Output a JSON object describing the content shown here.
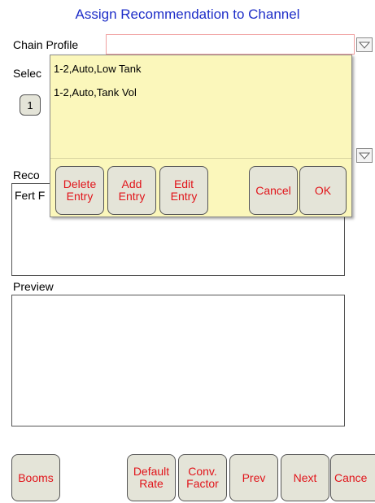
{
  "title": "Assign Recommendation to Channel",
  "chain_profile_label": "Chain Profile",
  "select_label": "Selec",
  "channel_button_label": "1",
  "reco_label": "Reco",
  "fert_label": "Fert F",
  "preview_label": "Preview",
  "popup": {
    "items": [
      "1-2,Auto,Low Tank",
      "1-2,Auto,Tank Vol"
    ],
    "buttons": {
      "delete": [
        "Delete",
        "Entry"
      ],
      "add": [
        "Add",
        "Entry"
      ],
      "edit": [
        "Edit",
        "Entry"
      ],
      "cancel": "Cancel",
      "ok": "OK"
    }
  },
  "bottom": {
    "booms": "Booms",
    "default_rate": [
      "Default",
      "Rate"
    ],
    "conv_factor": [
      "Conv.",
      "Factor"
    ],
    "prev": "Prev",
    "next": "Next",
    "cancel": "Cance"
  },
  "colors": {
    "title": "#1e2ec8",
    "button_text": "#e1141a",
    "button_bg": "#e4e4d8",
    "popup_bg": "#fbf7bb",
    "chain_profile_border": "#f0a0a0"
  },
  "icons": {
    "dropdown": "chevron-down-icon"
  }
}
